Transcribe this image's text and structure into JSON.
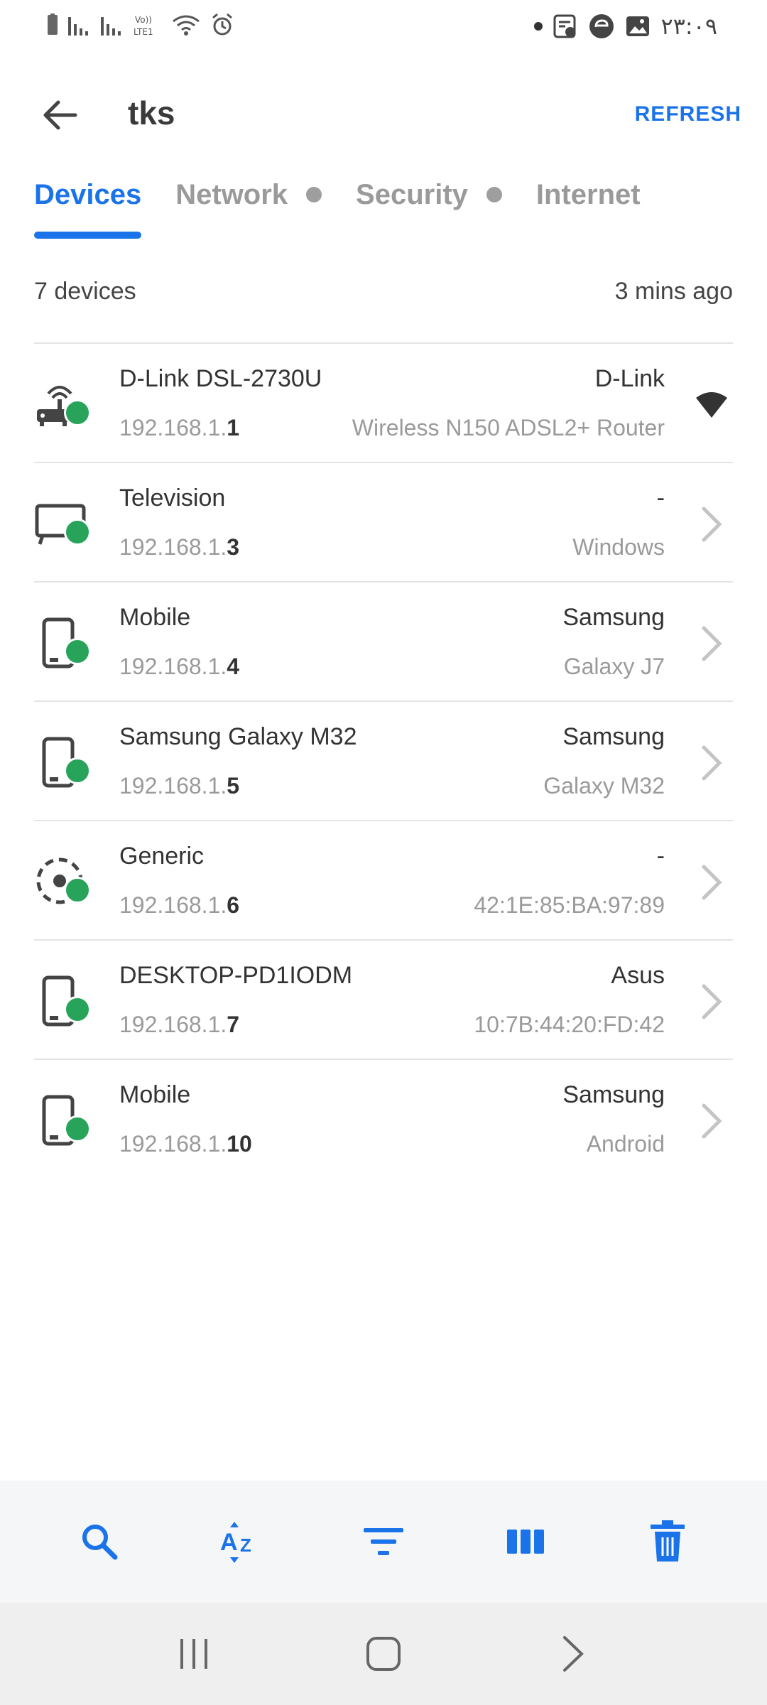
{
  "status_bar": {
    "time": "۲۳:۰۹",
    "lte_label": "LTE1"
  },
  "app_bar": {
    "title": "tks",
    "refresh_label": "REFRESH"
  },
  "tabs": [
    {
      "label": "Devices",
      "active": true
    },
    {
      "label": "Network",
      "has_dot": true
    },
    {
      "label": "Security",
      "has_dot": true
    },
    {
      "label": "Internet"
    }
  ],
  "summary": {
    "count_text": "7 devices",
    "updated_text": "3 mins ago"
  },
  "devices": [
    {
      "name": "D-Link DSL-2730U",
      "ip_prefix": "192.168.1.",
      "ip_suffix": "1",
      "brand": "D-Link",
      "model": "Wireless N150 ADSL2+ Router",
      "icon": "router-icon",
      "action_icon": "wifi-icon"
    },
    {
      "name": "Television",
      "ip_prefix": "192.168.1.",
      "ip_suffix": "3",
      "brand": "-",
      "model": "Windows",
      "icon": "tv-icon",
      "action_icon": "chevron-right-icon"
    },
    {
      "name": "Mobile",
      "ip_prefix": "192.168.1.",
      "ip_suffix": "4",
      "brand": "Samsung",
      "model": "Galaxy J7",
      "icon": "phone-icon",
      "action_icon": "chevron-right-icon"
    },
    {
      "name": "Samsung Galaxy M32",
      "ip_prefix": "192.168.1.",
      "ip_suffix": "5",
      "brand": "Samsung",
      "model": "Galaxy M32",
      "icon": "phone-icon",
      "action_icon": "chevron-right-icon"
    },
    {
      "name": "Generic",
      "ip_prefix": "192.168.1.",
      "ip_suffix": "6",
      "brand": "-",
      "model": "42:1E:85:BA:97:89",
      "icon": "generic-device-icon",
      "action_icon": "chevron-right-icon"
    },
    {
      "name": "DESKTOP-PD1IODM",
      "ip_prefix": "192.168.1.",
      "ip_suffix": "7",
      "brand": "Asus",
      "model": "10:7B:44:20:FD:42",
      "icon": "phone-icon",
      "action_icon": "chevron-right-icon"
    },
    {
      "name": "Mobile",
      "ip_prefix": "192.168.1.",
      "ip_suffix": "10",
      "brand": "Samsung",
      "model": "Android",
      "icon": "phone-icon",
      "action_icon": "chevron-right-icon"
    }
  ],
  "toolbar": [
    "search-icon",
    "sort-az-icon",
    "filter-icon",
    "columns-icon",
    "delete-icon"
  ],
  "nav_bar": [
    "recents-icon",
    "home-icon",
    "back-icon"
  ],
  "colors": {
    "accent": "#1a73e8",
    "online": "#27a35a",
    "toolbar_bg": "#f5f6f8",
    "nav_bg": "#efefef"
  }
}
